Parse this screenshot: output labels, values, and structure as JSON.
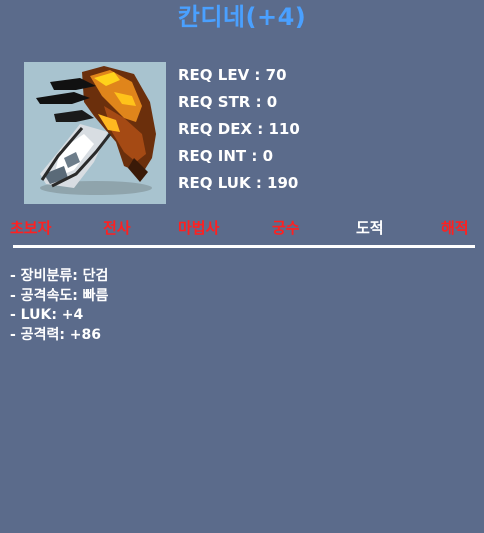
{
  "item": {
    "name": "칸디네(+4)",
    "icon": "dagger-claw-icon"
  },
  "requirements": [
    "REQ LEV : 70",
    "REQ STR : 0",
    "REQ DEX : 110",
    "REQ INT : 0",
    "REQ LUK : 190"
  ],
  "jobs": [
    {
      "label": "초보자",
      "usable": false
    },
    {
      "label": "전사",
      "usable": false
    },
    {
      "label": "마법사",
      "usable": false
    },
    {
      "label": "궁수",
      "usable": false
    },
    {
      "label": "도적",
      "usable": true
    },
    {
      "label": "해적",
      "usable": false
    }
  ],
  "stats": [
    "- 장비분류: 단검",
    "- 공격속도: 빠름",
    "- LUK: +4",
    "- 공격력: +86"
  ],
  "colors": {
    "background": "#5b6b8b",
    "title": "#4aa0ff",
    "unusable_job": "#ff2020",
    "usable_job": "#ffffff"
  }
}
